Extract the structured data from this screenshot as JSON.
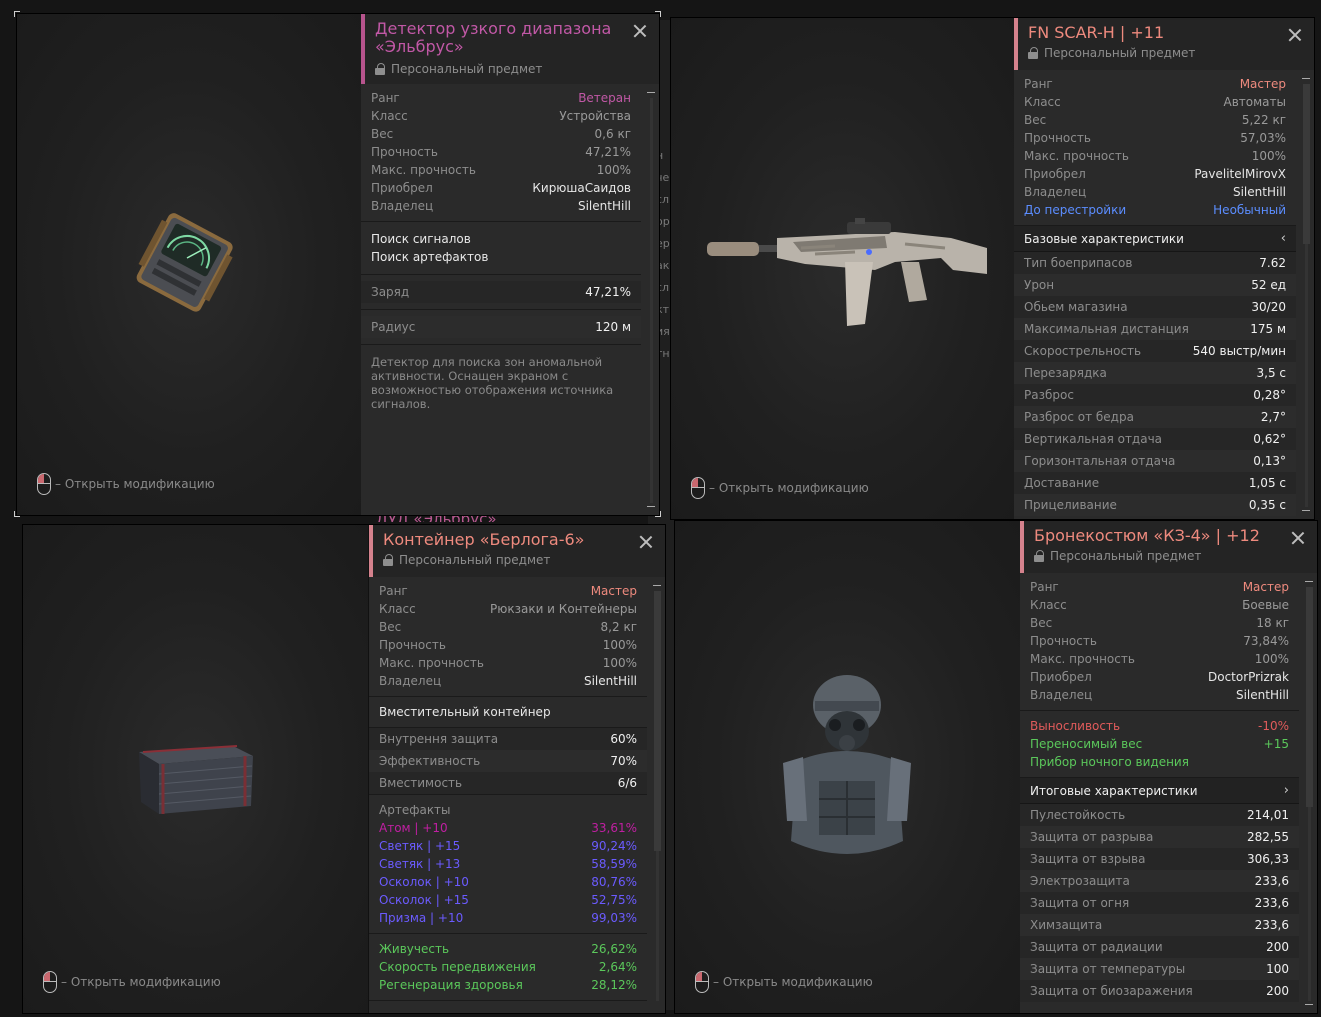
{
  "colors": {
    "veteran": "#c158a6",
    "master": "#ee8a7e",
    "rare": "#5b8dff",
    "unusual_blue": "#5b8dff",
    "neg": "#e05b5b",
    "pos": "#5bc85b",
    "atom": "#c01fa2",
    "light": "#6b5bff"
  },
  "background_fragments": {
    "left": [
      "н",
      "че",
      "сл",
      "ор",
      "ер",
      "ак",
      "сл",
      "кт",
      "ия",
      "тн"
    ],
    "bottom_title": "ДУД «Эльбрус»"
  },
  "detector": {
    "title": "Детектор узкого диапазона «Эльбрус»",
    "subtitle": "Персональный предмет",
    "hint": "– Открыть модификацию",
    "info": [
      {
        "k": "Ранг",
        "v": "Ветеран"
      },
      {
        "k": "Класс",
        "v": "Устройства"
      },
      {
        "k": "Вес",
        "v": "0,6 кг"
      },
      {
        "k": "Прочность",
        "v": "47,21%"
      },
      {
        "k": "Макс. прочность",
        "v": "100%"
      },
      {
        "k": "Приобрел",
        "v": "КирюшаСаидов"
      },
      {
        "k": "Владелец",
        "v": "SilentHill"
      }
    ],
    "features": [
      "Поиск сигналов",
      "Поиск артефактов"
    ],
    "charge": {
      "k": "Заряд",
      "v": "47,21%"
    },
    "radius": {
      "k": "Радиус",
      "v": "120 м"
    },
    "description": "Детектор для поиска зон аномальной активности. Оснащен экраном с возможностью отображения источника сигналов."
  },
  "scar": {
    "title": "FN SCAR-H | +11",
    "subtitle": "Персональный предмет",
    "hint": "– Открыть модификацию",
    "info": [
      {
        "k": "Ранг",
        "v": "Мастер"
      },
      {
        "k": "Класс",
        "v": "Автоматы"
      },
      {
        "k": "Вес",
        "v": "5,22 кг"
      },
      {
        "k": "Прочность",
        "v": "57,03%"
      },
      {
        "k": "Макс. прочность",
        "v": "100%"
      },
      {
        "k": "Приобрел",
        "v": "PavelitelMirovX"
      },
      {
        "k": "Владелец",
        "v": "SilentHill"
      },
      {
        "k": "До перестройки",
        "v": "Необычный"
      }
    ],
    "section_title": "Базовые характеристики",
    "section_chevron": "‹",
    "stats": [
      {
        "k": "Тип боеприпасов",
        "v": "7.62"
      },
      {
        "k": "Урон",
        "v": "52 ед"
      },
      {
        "k": "Обьем магазина",
        "v": "30/20"
      },
      {
        "k": "Максимальная дистанция",
        "v": "175 м"
      },
      {
        "k": "Скорострельность",
        "v": "540 выстр/мин"
      },
      {
        "k": "Перезарядка",
        "v": "3,5 с"
      },
      {
        "k": "Разброс",
        "v": "0,28°"
      },
      {
        "k": "Разброс от бедра",
        "v": "2,7°"
      },
      {
        "k": "Вертикальная отдача",
        "v": "0,62°"
      },
      {
        "k": "Горизонтальная отдача",
        "v": "0,13°"
      },
      {
        "k": "Доставание",
        "v": "1,05 с"
      },
      {
        "k": "Прицеливание",
        "v": "0,35 с"
      }
    ]
  },
  "container": {
    "title": "Контейнер «Берлога-6»",
    "subtitle": "Персональный предмет",
    "hint": "– Открыть модификацию",
    "info": [
      {
        "k": "Ранг",
        "v": "Мастер"
      },
      {
        "k": "Класс",
        "v": "Рюкзаки и Контейнеры"
      },
      {
        "k": "Вес",
        "v": "8,2 кг"
      },
      {
        "k": "Прочность",
        "v": "100%"
      },
      {
        "k": "Макс. прочность",
        "v": "100%"
      },
      {
        "k": "Владелец",
        "v": "SilentHill"
      }
    ],
    "feature": "Вместительный контейнер",
    "stats": [
      {
        "k": "Внутрення защита",
        "v": "60%"
      },
      {
        "k": "Эффективность",
        "v": "70%"
      },
      {
        "k": "Вместимость",
        "v": "6/6"
      }
    ],
    "artifacts_title": "Артефакты",
    "artifacts": [
      {
        "k": "Атом | +10",
        "v": "33,61%",
        "color": "#c01fa2"
      },
      {
        "k": "Светяк | +15",
        "v": "90,24%",
        "color": "#6b5bff"
      },
      {
        "k": "Светяк | +13",
        "v": "58,59%",
        "color": "#6b5bff"
      },
      {
        "k": "Осколок | +10",
        "v": "80,76%",
        "color": "#6b5bff"
      },
      {
        "k": "Осколок | +15",
        "v": "52,75%",
        "color": "#6b5bff"
      },
      {
        "k": "Призма | +10",
        "v": "99,03%",
        "color": "#6b5bff"
      }
    ],
    "effects": [
      {
        "k": "Живучесть",
        "v": "26,62%"
      },
      {
        "k": "Скорость передвижения",
        "v": "2,64%"
      },
      {
        "k": "Регенерация здоровья",
        "v": "28,12%"
      }
    ]
  },
  "armor": {
    "title": "Бронекостюм «КЗ-4» | +12",
    "subtitle": "Персональный предмет",
    "hint": "– Открыть модификацию",
    "info": [
      {
        "k": "Ранг",
        "v": "Мастер"
      },
      {
        "k": "Класс",
        "v": "Боевые"
      },
      {
        "k": "Вес",
        "v": "18 кг"
      },
      {
        "k": "Прочность",
        "v": "73,84%"
      },
      {
        "k": "Макс. прочность",
        "v": "100%"
      },
      {
        "k": "Приобрел",
        "v": "DoctorPrizrak"
      },
      {
        "k": "Владелец",
        "v": "SilentHill"
      }
    ],
    "modifiers": [
      {
        "k": "Выносливость",
        "v": "-10%",
        "color": "#e05b5b"
      },
      {
        "k": "Переносимый вес",
        "v": "+15",
        "color": "#5bc85b"
      },
      {
        "k": "Прибор ночного видения",
        "v": "",
        "color": "#5bc85b"
      }
    ],
    "section_title": "Итоговые характеристики",
    "section_chevron": "›",
    "stats": [
      {
        "k": "Пулестойкость",
        "v": "214,01"
      },
      {
        "k": "Защита от разрыва",
        "v": "282,55"
      },
      {
        "k": "Защита от взрыва",
        "v": "306,33"
      },
      {
        "k": "Электрозащита",
        "v": "233,6"
      },
      {
        "k": "Защита от огня",
        "v": "233,6"
      },
      {
        "k": "Химзащита",
        "v": "233,6"
      },
      {
        "k": "Защита от радиации",
        "v": "200"
      },
      {
        "k": "Защита от температуры",
        "v": "100"
      },
      {
        "k": "Защита от биозаражения",
        "v": "200"
      }
    ]
  }
}
